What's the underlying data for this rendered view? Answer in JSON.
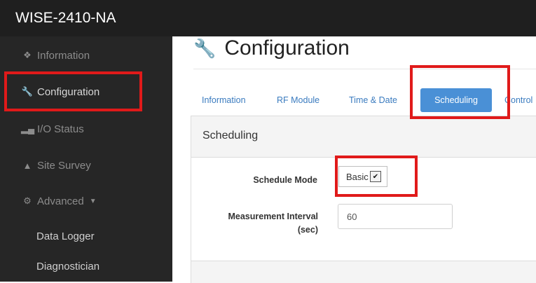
{
  "app": {
    "title": "WISE-2410-NA"
  },
  "sidebar": {
    "items": [
      {
        "label": "Information",
        "icon": "info-circle-icon"
      },
      {
        "label": "Configuration",
        "icon": "wrench-icon"
      },
      {
        "label": "I/O Status",
        "icon": "bar-chart-icon"
      },
      {
        "label": "Site Survey",
        "icon": "sitemap-icon"
      },
      {
        "label": "Advanced",
        "icon": "cogs-icon"
      }
    ],
    "subitems": [
      {
        "label": "Data Logger"
      },
      {
        "label": "Diagnostician"
      }
    ]
  },
  "page": {
    "title": "Configuration"
  },
  "tabs": [
    {
      "label": "Information"
    },
    {
      "label": "RF Module"
    },
    {
      "label": "Time & Date"
    },
    {
      "label": "Scheduling"
    },
    {
      "label": "Control"
    }
  ],
  "panel": {
    "title": "Scheduling",
    "schedule_mode": {
      "label": "Schedule Mode",
      "value": "Basic"
    },
    "measurement_interval": {
      "label_line1": "Measurement Interval",
      "label_line2": "(sec)",
      "value": "60"
    }
  },
  "colors": {
    "accent": "#4a90d6",
    "highlight": "#e01a1a",
    "sidebar": "#262626"
  }
}
